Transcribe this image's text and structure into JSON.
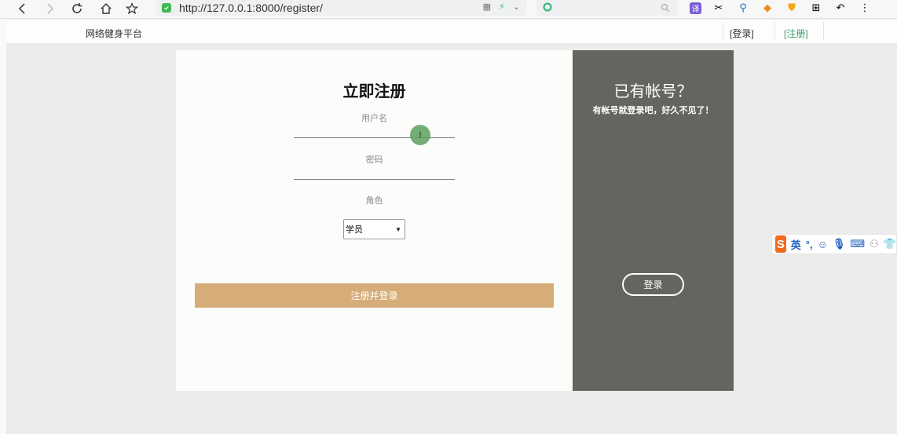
{
  "browser": {
    "url": "http://127.0.0.1:8000/register/"
  },
  "site": {
    "brand": "网络健身平台",
    "nav_login": "[登录]",
    "nav_register": "[注册]"
  },
  "register_form": {
    "title": "立即注册",
    "username_label": "用户名",
    "username_value": "",
    "password_label": "密码",
    "password_value": "",
    "role_label": "角色",
    "role_selected": "学员",
    "submit_label": "注册并登录"
  },
  "side_panel": {
    "title": "已有帐号？",
    "subtitle": "有帐号就登录吧，好久不见了！",
    "login_label": "登录"
  },
  "ime": {
    "mode": "英"
  },
  "colors": {
    "accent": "#d6ad78",
    "side_bg": "#646461",
    "nav_active": "#3c9a6b"
  }
}
